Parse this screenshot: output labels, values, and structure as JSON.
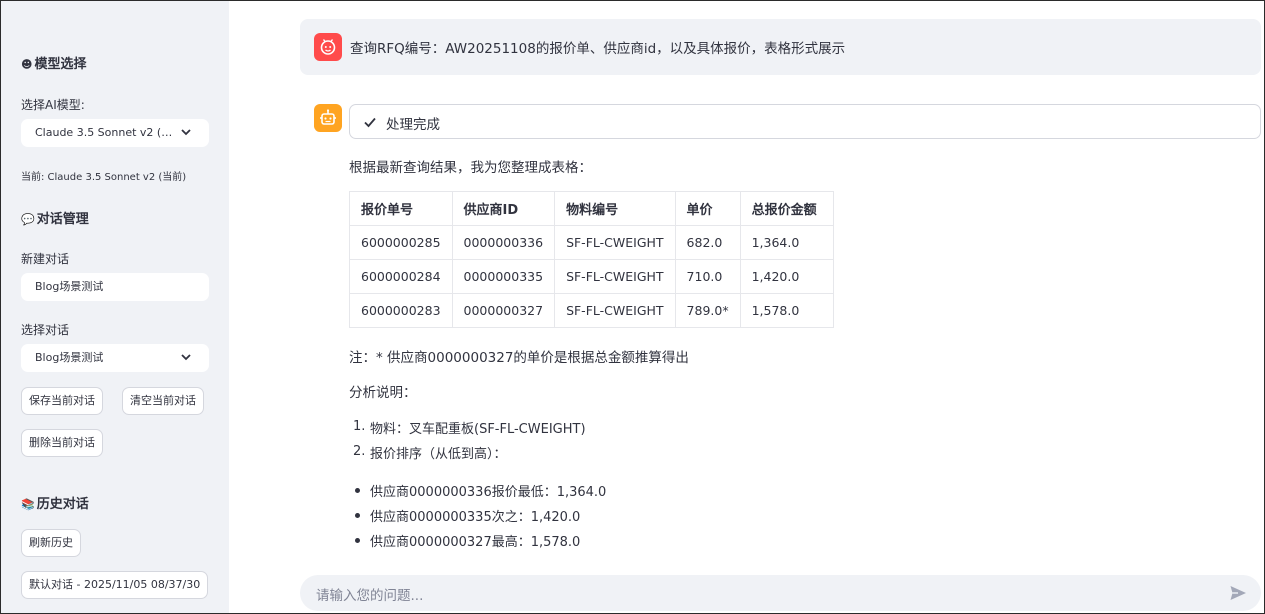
{
  "sidebar": {
    "model_heading": "模型选择",
    "model_label": "选择AI模型:",
    "model_select": "Claude 3.5 Sonnet v2 (…",
    "current_model": "当前: Claude 3.5 Sonnet v2 (当前)",
    "conversation_heading": "对话管理",
    "new_conv_label": "新建对话",
    "new_conv_value": "Blog场景测试",
    "select_conv_label": "选择对话",
    "select_conv_value": "Blog场景测试",
    "save_button": "保存当前对话",
    "clear_button": "清空当前对话",
    "delete_button": "删除当前对话",
    "history_heading": "历史对话",
    "refresh_button": "刷新历史",
    "history_item": "默认对话 - 2025/11/05 08/37/30"
  },
  "chat": {
    "user_message": "查询RFQ编号：AW20251108的报价单、供应商id，以及具体报价，表格形式展示",
    "status": "处理完成",
    "intro": "根据最新查询结果，我为您整理成表格：",
    "table": {
      "headers": [
        "报价单号",
        "供应商ID",
        "物料编号",
        "单价",
        "总报价金额"
      ],
      "rows": [
        [
          "6000000285",
          "0000000336",
          "SF-FL-CWEIGHT",
          "682.0",
          "1,364.0"
        ],
        [
          "6000000284",
          "0000000335",
          "SF-FL-CWEIGHT",
          "710.0",
          "1,420.0"
        ],
        [
          "6000000283",
          "0000000327",
          "SF-FL-CWEIGHT",
          "789.0*",
          "1,578.0"
        ]
      ]
    },
    "note": "注：* 供应商0000000327的单价是根据总金额推算得出",
    "analysis_title": "分析说明：",
    "ordered": [
      "物料：叉车配重板(SF-FL-CWEIGHT)",
      "报价排序（从低到高）："
    ],
    "bullets": [
      "供应商0000000336报价最低：1,364.0",
      "供应商0000000335次之：1,420.0",
      "供应商0000000327最高：1,578.0"
    ],
    "input_placeholder": "请输入您的问题..."
  },
  "colors": {
    "user_avatar": "#ff4b4b",
    "bot_avatar": "#ffa421",
    "sidebar_bg": "#f0f2f6"
  }
}
